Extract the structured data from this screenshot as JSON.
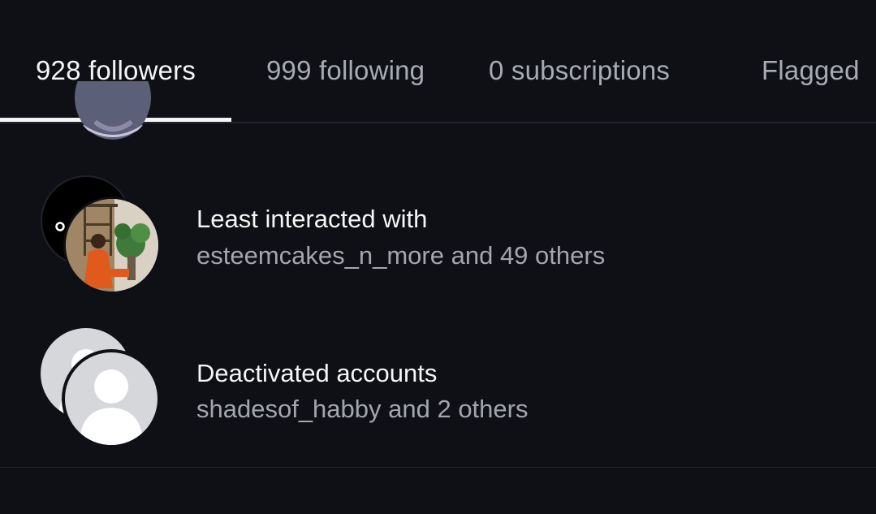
{
  "tabs": [
    {
      "label": "928 followers",
      "active": true
    },
    {
      "label": "999 following",
      "active": false
    },
    {
      "label": "0 subscriptions",
      "active": false
    },
    {
      "label": "Flagged",
      "active": false
    }
  ],
  "categories": [
    {
      "title": "Least interacted with",
      "subtitle": "esteemcakes_n_more and 49 others"
    },
    {
      "title": "Deactivated accounts",
      "subtitle": "shadesof_habby and 2 others"
    }
  ],
  "colors": {
    "background": "#0e1015",
    "text_primary": "#f5f5f5",
    "text_secondary": "#a3a6ad",
    "divider": "#23262c"
  }
}
